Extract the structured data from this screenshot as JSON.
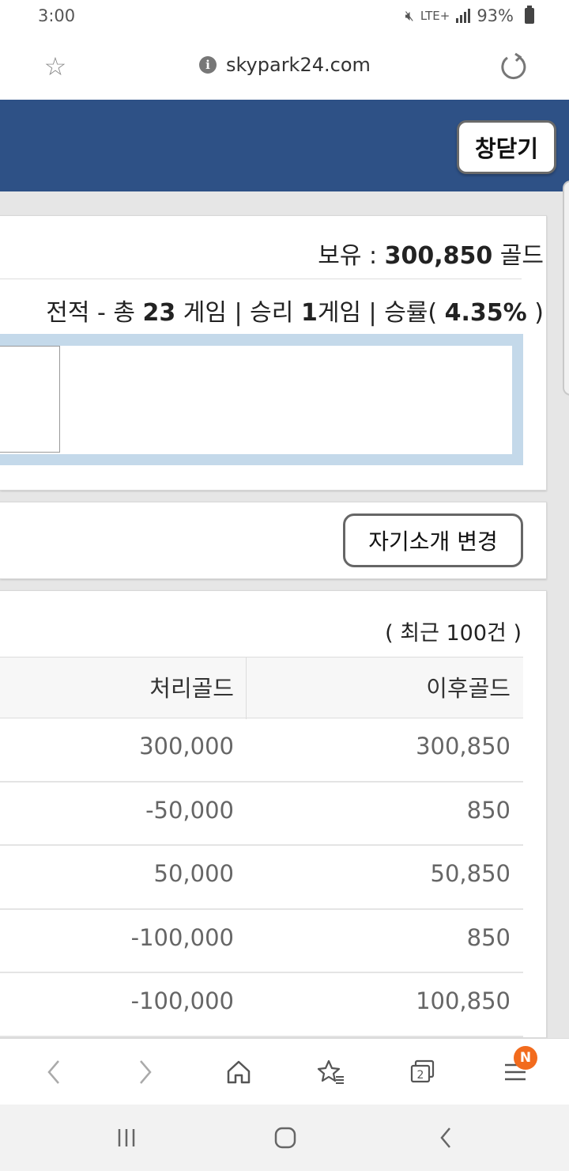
{
  "status_bar": {
    "time": "3:00",
    "network": "LTE+",
    "battery": "93%"
  },
  "browser": {
    "url": "skypark24.com"
  },
  "header": {
    "close_label": "창닫기"
  },
  "profile": {
    "gold_label": "보유 :",
    "gold_value": "300,850",
    "gold_unit": "골드",
    "record_prefix": "전적 - 총",
    "total_games": "23",
    "games_unit": "게임 | 승리",
    "wins": "1",
    "wins_unit": "게임 | 승률(",
    "win_rate": "4.35%",
    "win_rate_suffix": ")"
  },
  "intro": {
    "change_button": "자기소개 변경"
  },
  "history": {
    "recent_label": "( 최근 100건 )",
    "columns": [
      "처리골드",
      "이후골드"
    ],
    "rows": [
      [
        "300,000",
        "300,850"
      ],
      [
        "-50,000",
        "850"
      ],
      [
        "50,000",
        "50,850"
      ],
      [
        "-100,000",
        "850"
      ],
      [
        "-100,000",
        "100,850"
      ]
    ]
  },
  "bottom_bar": {
    "tabs_count": "2",
    "menu_badge": "N"
  }
}
